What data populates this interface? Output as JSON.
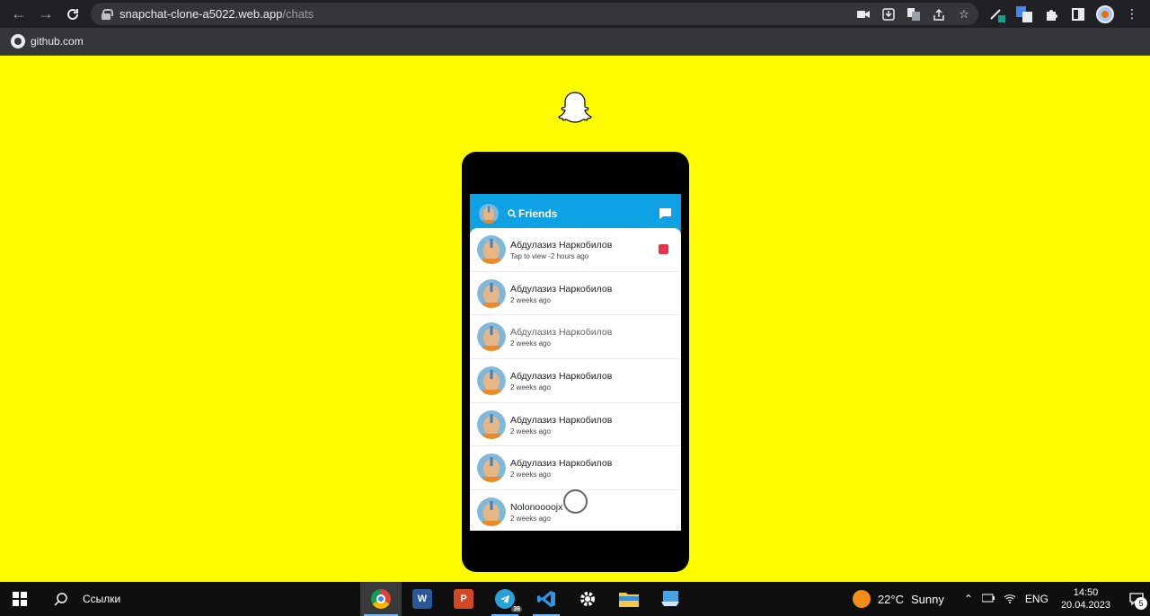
{
  "browser": {
    "url_host": "snapchat-clone-a5022.web.app",
    "url_path": "/chats",
    "bookmarks": [
      {
        "label": "github.com"
      }
    ]
  },
  "app": {
    "header": {
      "search_label": "Friends"
    },
    "chats": [
      {
        "name": "Абдулазиз Наркобилов",
        "status": "Tap to view -2 hours ago",
        "new_snap": true,
        "muted": false
      },
      {
        "name": "Абдулазиз Наркобилов",
        "status": "2 weeks ago",
        "new_snap": false,
        "muted": false
      },
      {
        "name": "Абдулазиз Наркобилов",
        "status": "2 weeks ago",
        "new_snap": false,
        "muted": true
      },
      {
        "name": "Абдулазиз Наркобилов",
        "status": "2 weeks ago",
        "new_snap": false,
        "muted": false
      },
      {
        "name": "Абдулазиз Наркобилов",
        "status": "2 weeks ago",
        "new_snap": false,
        "muted": false
      },
      {
        "name": "Абдулазиз Наркобилов",
        "status": "2 weeks ago",
        "new_snap": false,
        "muted": false
      },
      {
        "name": "Nolonoooojx",
        "status": "2 weeks ago",
        "new_snap": false,
        "muted": false
      }
    ],
    "colors": {
      "background": "#fffc00",
      "header": "#0ea1e3",
      "new_snap": "#e4324b"
    }
  },
  "taskbar": {
    "links_label": "Ссылки",
    "apps": [
      {
        "name": "chrome-icon",
        "active": true
      },
      {
        "name": "word-icon",
        "label": "W"
      },
      {
        "name": "powerpoint-icon",
        "label": "P"
      },
      {
        "name": "telegram-icon",
        "badge": "36"
      },
      {
        "name": "vscode-icon"
      },
      {
        "name": "settings-icon"
      },
      {
        "name": "file-explorer-icon"
      },
      {
        "name": "monitor-app-icon"
      }
    ],
    "weather": {
      "temp": "22°C",
      "condition": "Sunny"
    },
    "language": "ENG",
    "time": "14:50",
    "date": "20.04.2023",
    "notifications": "5"
  }
}
